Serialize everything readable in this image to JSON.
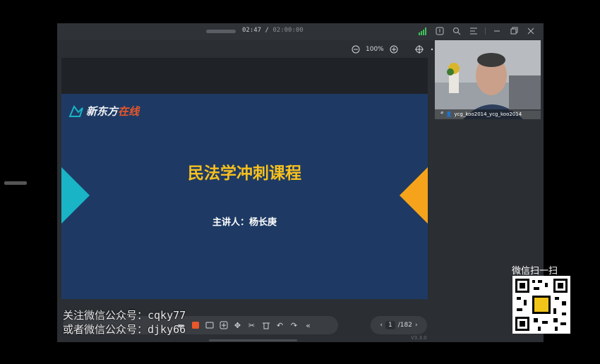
{
  "player": {
    "time_current": "02:47",
    "time_separator": "/",
    "time_total": "02:00:00",
    "zoom": "100%",
    "signal_label": "1"
  },
  "slide": {
    "logo_part1": "新东方",
    "logo_part2": "在线",
    "title": "民法学冲刺课程",
    "speaker": "主讲人：杨长庚"
  },
  "pager": {
    "current": "1",
    "total": "/182"
  },
  "version": "V3.3.0",
  "video": {
    "user_label": "ycg_koo2014_ycg_koo2014"
  },
  "overlay": {
    "line1": "关注微信公众号：cqky77",
    "line2": "或者微信公众号：djky66",
    "wechat_scan": "微信扫一扫"
  },
  "colors": {
    "slide_bg": "#1e3a64",
    "title": "#f7c01e",
    "accent_cyan": "#19b4c6",
    "accent_orange": "#f5a31a"
  }
}
